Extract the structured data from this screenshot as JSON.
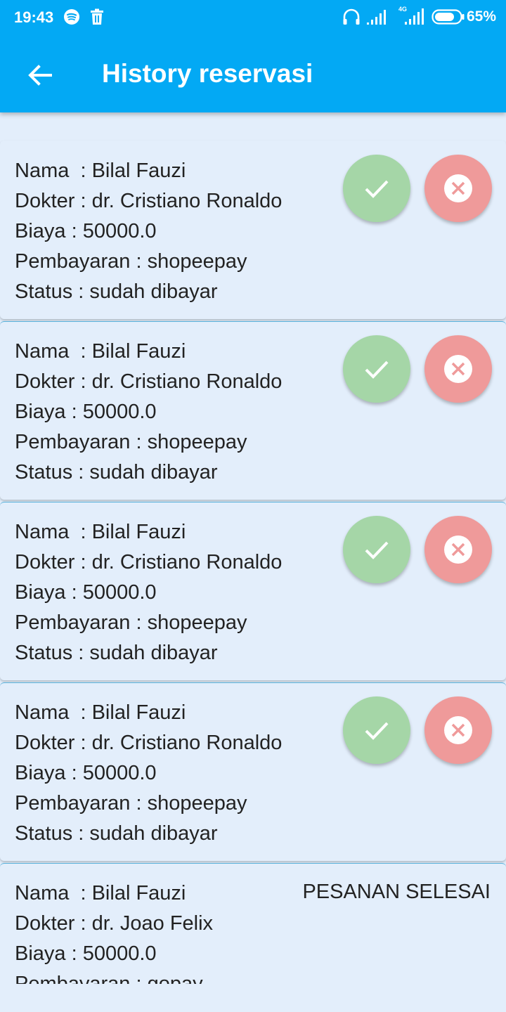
{
  "status_bar": {
    "time": "19:43",
    "battery": "65%",
    "network_label": "4G",
    "icons": [
      "spotify-icon",
      "trash-icon",
      "headphones-icon",
      "signal-icon",
      "signal-4g-icon",
      "battery-icon"
    ]
  },
  "app_bar": {
    "title": "History reservasi",
    "back_icon": "arrow-back-icon",
    "color": "#03a9f4"
  },
  "reservations": [
    {
      "nama": "Nama  : Bilal Fauzi",
      "dokter": "Dokter : dr. Cristiano Ronaldo",
      "biaya": "Biaya : 50000.0",
      "pembayaran": "Pembayaran : shopeepay",
      "status": "Status : sudah dibayar"
    },
    {
      "nama": "Nama  : Bilal Fauzi",
      "dokter": "Dokter : dr. Cristiano Ronaldo",
      "biaya": "Biaya : 50000.0",
      "pembayaran": "Pembayaran : shopeepay",
      "status": "Status : sudah dibayar"
    },
    {
      "nama": "Nama  : Bilal Fauzi",
      "dokter": "Dokter : dr. Cristiano Ronaldo",
      "biaya": "Biaya : 50000.0",
      "pembayaran": "Pembayaran : shopeepay",
      "status": "Status : sudah dibayar"
    },
    {
      "nama": "Nama  : Bilal Fauzi",
      "dokter": "Dokter : dr. Cristiano Ronaldo",
      "biaya": "Biaya : 50000.0",
      "pembayaran": "Pembayaran : shopeepay",
      "status": "Status : sudah dibayar"
    },
    {
      "nama": "Nama  : Bilal Fauzi",
      "dokter": "Dokter : dr. Joao Felix",
      "biaya": "Biaya : 50000.0",
      "pembayaran": "Pembayaran : gopay",
      "done_label": "PESANAN SELESAI"
    }
  ],
  "colors": {
    "confirm": "#a5d6a7",
    "cancel": "#ef9a9a",
    "background": "#e3eefb"
  }
}
